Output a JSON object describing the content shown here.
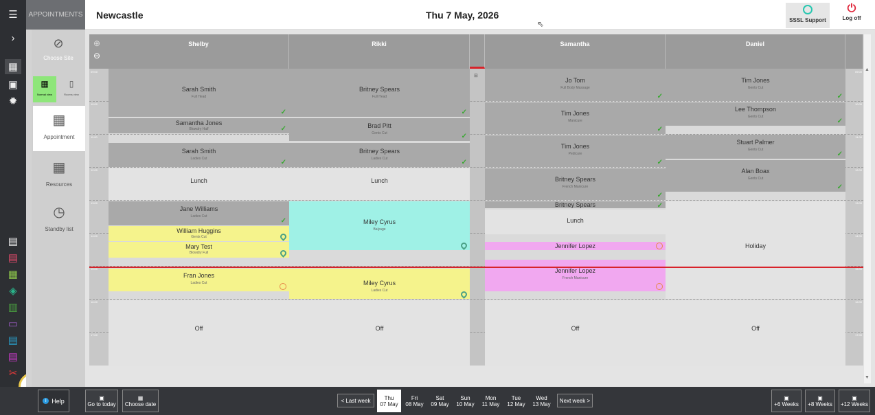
{
  "app": {
    "section": "APPOINTMENTS",
    "site": "Newcastle",
    "date": "Thu 7 May, 2026"
  },
  "header": {
    "support": "SSSL Support",
    "logoff": "Log off"
  },
  "side": {
    "choose_site": "Choose Site",
    "normal_view": "Normal view",
    "rooms_view": "Rooms view",
    "appointment": "Appointment",
    "resources": "Resources",
    "standby": "Standby list"
  },
  "help": "Help",
  "footer": {
    "today": "Go to today",
    "choose_date": "Choose date",
    "last_week": "< Last week",
    "next_week": "Next week >",
    "plus6": "+6 Weeks",
    "plus8": "+8 Weeks",
    "plus12": "+12 Weeks",
    "days": [
      {
        "d": "Thu",
        "m": "07 May"
      },
      {
        "d": "Fri",
        "m": "08 May"
      },
      {
        "d": "Sat",
        "m": "09 May"
      },
      {
        "d": "Sun",
        "m": "10 May"
      },
      {
        "d": "Mon",
        "m": "11 May"
      },
      {
        "d": "Tue",
        "m": "12 May"
      },
      {
        "d": "Wed",
        "m": "13 May"
      }
    ]
  },
  "times": [
    "09:00",
    "10:00",
    "11:00",
    "12:00",
    "13:00",
    "14:00",
    "15:00",
    "16:00",
    "17:00"
  ],
  "staff": [
    "Shelby",
    "Rikki",
    "Samantha",
    "Daniel"
  ],
  "appts": {
    "shelby": [
      {
        "n": "Sarah Smith",
        "s": "Full Head"
      },
      {
        "n": "Samantha Jones",
        "s": "Blowdry Half"
      },
      {
        "n": "Sarah Smith",
        "s": "Ladies Cut"
      },
      {
        "n": "Lunch"
      },
      {
        "n": "Jane Williams",
        "s": "Ladies Cut"
      },
      {
        "n": "William Huggins",
        "s": "Gents Cut"
      },
      {
        "n": "Mary Test",
        "s": "Blowdry Full"
      },
      {
        "n": "Fran Jones",
        "s": "Ladies Cut"
      },
      {
        "n": "Off"
      }
    ],
    "rikki": [
      {
        "n": "Britney Spears",
        "s": "Full Head"
      },
      {
        "n": "Brad Pitt",
        "s": "Gents Cut"
      },
      {
        "n": "Britney Spears",
        "s": "Ladies Cut"
      },
      {
        "n": "Lunch"
      },
      {
        "n": "Miley Cyrus",
        "s": "Balyage"
      },
      {
        "n": "Miley Cyrus",
        "s": "Ladies Cut"
      },
      {
        "n": "Off"
      }
    ],
    "samantha": [
      {
        "n": "Jo Tom",
        "s": "Full Body Massage"
      },
      {
        "n": "Tim Jones",
        "s": "Manicure"
      },
      {
        "n": "Tim Jones",
        "s": "Pedicure"
      },
      {
        "n": "Britney Spears",
        "s": "French Manicure"
      },
      {
        "n": "Britney Spears"
      },
      {
        "n": "Lunch"
      },
      {
        "n": "Jennifer Lopez"
      },
      {
        "n": "Jennifer Lopez",
        "s": "French Manicure"
      },
      {
        "n": "Off"
      }
    ],
    "daniel": [
      {
        "n": "Tim Jones",
        "s": "Gents Cut"
      },
      {
        "n": "Lee Thompson",
        "s": "Gents Cut"
      },
      {
        "n": "Stuart Palmer",
        "s": "Gents Cut"
      },
      {
        "n": "Alan Boax",
        "s": "Gents Cut"
      },
      {
        "n": "Holiday"
      },
      {
        "n": "Off"
      }
    ]
  }
}
